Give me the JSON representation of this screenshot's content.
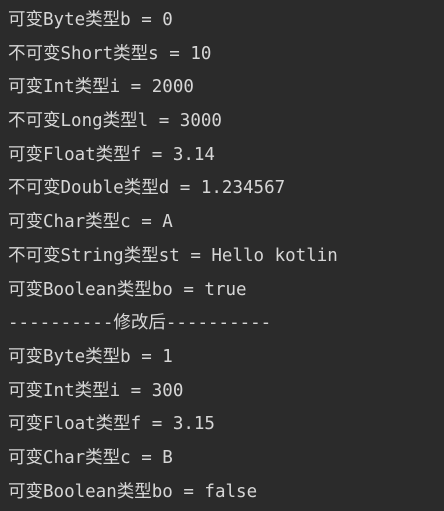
{
  "console": {
    "lines": [
      "可变Byte类型b = 0",
      "不可变Short类型s = 10",
      "可变Int类型i = 2000",
      "不可变Long类型l = 3000",
      "可变Float类型f = 3.14",
      "不可变Double类型d = 1.234567",
      "可变Char类型c = A",
      "不可变String类型st = Hello kotlin",
      "可变Boolean类型bo = true",
      "----------修改后----------",
      "可变Byte类型b = 1",
      "可变Int类型i = 300",
      "可变Float类型f = 3.15",
      "可变Char类型c = B",
      "可变Boolean类型bo = false"
    ]
  },
  "colors": {
    "background": "#2b2b2b",
    "text": "#d6d6d6"
  }
}
